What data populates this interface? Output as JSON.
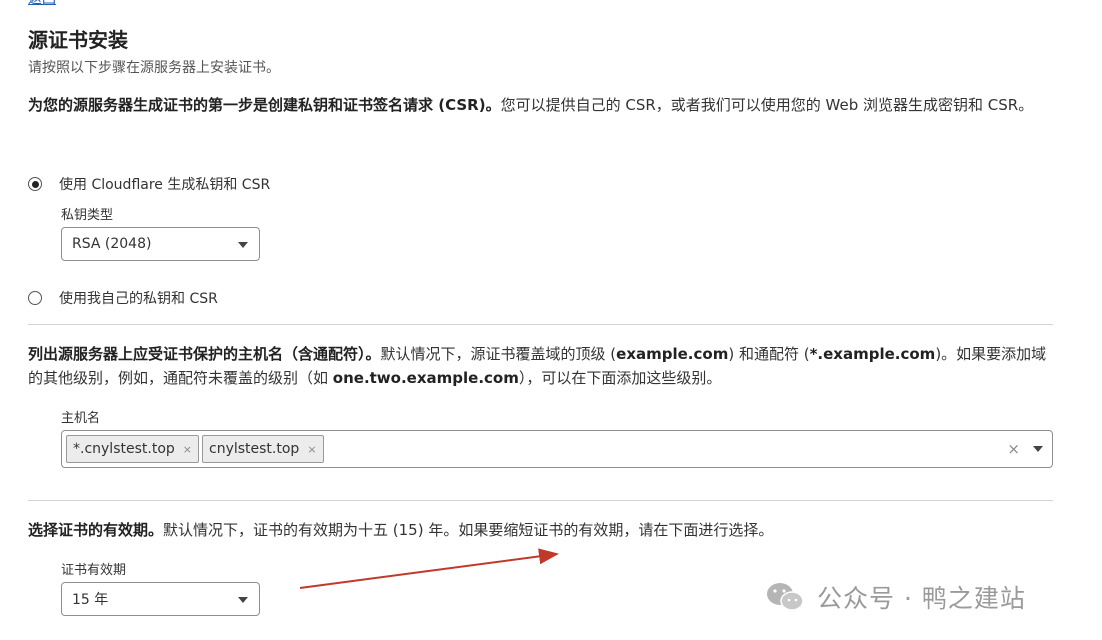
{
  "back_link": "返回",
  "page_title": "源证书安装",
  "subtitle": "请按照以下步骤在源服务器上安装证书。",
  "section1": {
    "bold": "为您的源服务器生成证书的第一步是创建私钥和证书签名请求 (CSR)。",
    "text": "您可以提供自己的 CSR，或者我们可以使用您的 Web 浏览器生成密钥和 CSR。"
  },
  "radio_cloudflare": {
    "label": "使用 Cloudflare 生成私钥和 CSR",
    "checked": true
  },
  "key_type": {
    "label": "私钥类型",
    "value": "RSA (2048)"
  },
  "radio_own": {
    "label": "使用我自己的私钥和 CSR",
    "checked": false
  },
  "section2": {
    "bold1": "列出源服务器上应受证书保护的主机名（含通配符）。",
    "text1": "默认情况下，源证书覆盖域的顶级 (",
    "bold2": "example.com",
    "text2": ") 和通配符 (",
    "bold3": "*.example.com",
    "text3": ")。如果要添加域的其他级别，例如，通配符未覆盖的级别（如 ",
    "bold4": "one.two.example.com",
    "text4": "），可以在下面添加这些级别。"
  },
  "hostnames": {
    "label": "主机名",
    "tags": [
      "*.cnylstest.top",
      "cnylstest.top"
    ],
    "tag_remove": "×",
    "clear": "×"
  },
  "section3": {
    "bold": "选择证书的有效期。",
    "text": "默认情况下，证书的有效期为十五 (15) 年。如果要缩短证书的有效期，请在下面进行选择。"
  },
  "validity": {
    "label": "证书有效期",
    "value": "15 年"
  },
  "watermark": "公众号 · 鸭之建站",
  "colors": {
    "arrow": "#c0392b",
    "link": "#1f5fb4"
  }
}
